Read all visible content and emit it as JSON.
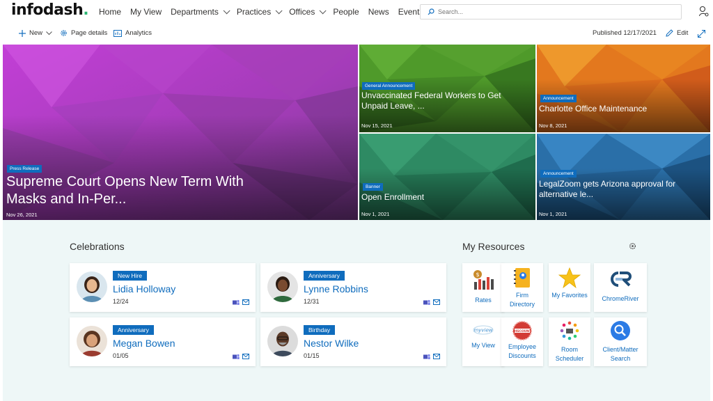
{
  "brand": {
    "name": "infodash",
    "dot": ".",
    "accent": "#2bb673"
  },
  "nav": {
    "items": [
      {
        "label": "Home",
        "dropdown": false
      },
      {
        "label": "My View",
        "dropdown": false
      },
      {
        "label": "Departments",
        "dropdown": true
      },
      {
        "label": "Practices",
        "dropdown": true
      },
      {
        "label": "Offices",
        "dropdown": true
      },
      {
        "label": "People",
        "dropdown": false
      },
      {
        "label": "News",
        "dropdown": false
      },
      {
        "label": "Events",
        "dropdown": false
      }
    ],
    "search_placeholder": "Search..."
  },
  "command_bar": {
    "new_label": "New",
    "page_details_label": "Page details",
    "analytics_label": "Analytics",
    "published_label": "Published 12/17/2021",
    "edit_label": "Edit"
  },
  "hero": [
    {
      "badge": "Press Release",
      "title": "Supreme Court Opens New Term With Masks and In-Per...",
      "date": "Nov 26, 2021"
    },
    {
      "badge": "General Announcement",
      "title": "Unvaccinated Federal Workers to Get Unpaid Leave, ...",
      "date": "Nov 15, 2021"
    },
    {
      "badge": "Announcement",
      "title": "Charlotte Office Maintenance",
      "date": "Nov 8, 2021"
    },
    {
      "badge": "Banner",
      "title": "Open Enrollment",
      "date": "Nov 1, 2021"
    },
    {
      "badge": "Announcement",
      "title": "LegalZoom gets Arizona approval for alternative le...",
      "date": "Nov 1, 2021"
    }
  ],
  "celebrations": {
    "title": "Celebrations",
    "people": [
      {
        "tag": "New Hire",
        "name": "Lidia Holloway",
        "date": "12/24"
      },
      {
        "tag": "Anniversary",
        "name": "Lynne Robbins",
        "date": "12/31"
      },
      {
        "tag": "Anniversary",
        "name": "Megan Bowen",
        "date": "01/05"
      },
      {
        "tag": "Birthday",
        "name": "Nestor Wilke",
        "date": "01/15"
      }
    ]
  },
  "resources": {
    "title": "My Resources",
    "items": [
      {
        "label": "Rates",
        "icon": "rates-chart-icon"
      },
      {
        "label": "Firm Directory",
        "icon": "directory-book-icon"
      },
      {
        "label": "My Favorites",
        "icon": "star-icon"
      },
      {
        "label": "ChromeRiver",
        "icon": "chromeriver-logo-icon"
      },
      {
        "label": "My View",
        "icon": "myview-logo-icon"
      },
      {
        "label": "Employee Discounts",
        "icon": "discount-badge-icon"
      },
      {
        "label": "Room Scheduler",
        "icon": "room-scheduler-icon"
      },
      {
        "label": "Client/Matter Search",
        "icon": "client-search-icon"
      }
    ]
  },
  "colors": {
    "link": "#0f6cbd",
    "badge": "#0f6cbd",
    "section_bg": "#eef7f7"
  }
}
